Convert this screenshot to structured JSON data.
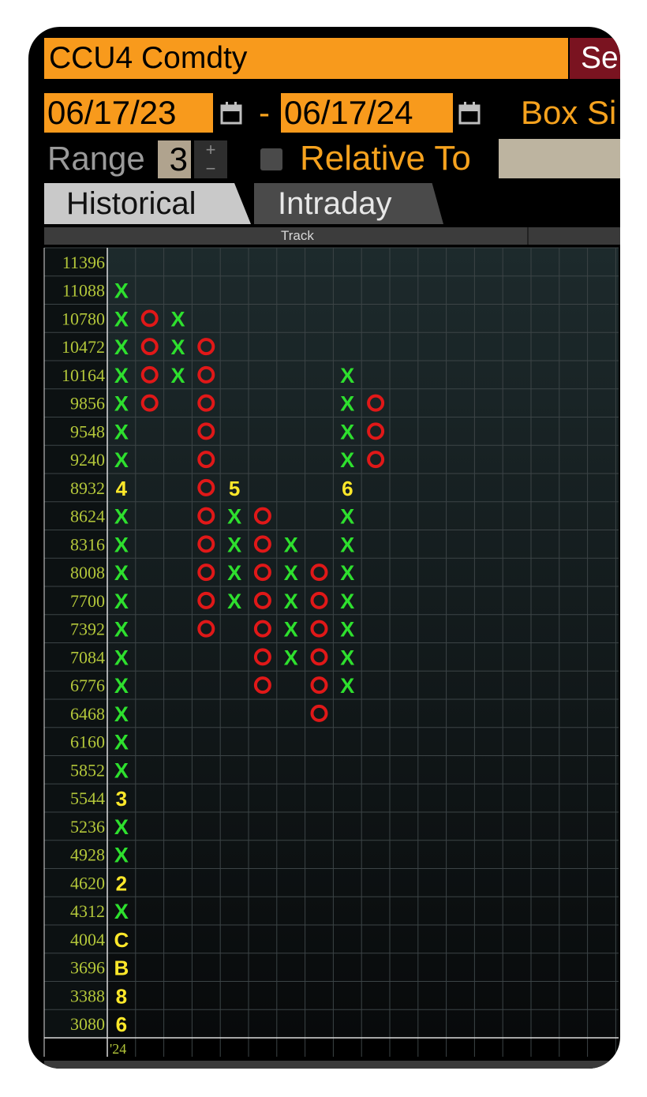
{
  "header": {
    "ticker": "CCU4 Comdty",
    "search_label": "Se",
    "start_date": "06/17/23",
    "date_separator": "-",
    "end_date": "06/17/24",
    "box_size_label": "Box Si",
    "range_label": "Range",
    "range_value": "3",
    "spinner_up": "+",
    "spinner_down": "−",
    "relative_to_label": "Relative To"
  },
  "tabs": [
    {
      "label": "Historical",
      "active": true
    },
    {
      "label": "Intraday",
      "active": false
    }
  ],
  "track_label": "Track",
  "colors": {
    "accent": "#f89a1c",
    "x_mark": "#2ee02e",
    "o_mark": "#e01818",
    "month_mark": "#ffe82a",
    "price_label": "#b3c63a"
  },
  "chart_data": {
    "type": "point-and-figure",
    "price_levels": [
      11396,
      11088,
      10780,
      10472,
      10164,
      9856,
      9548,
      9240,
      8932,
      8624,
      8316,
      8008,
      7700,
      7392,
      7084,
      6776,
      6468,
      6160,
      5852,
      5544,
      5236,
      4928,
      4620,
      4312,
      4004,
      3696,
      3388,
      3080
    ],
    "columns": [
      {
        "direction": "X",
        "low": 3080,
        "high": 11088,
        "month_marks": {
          "3080": "6",
          "3388": "8",
          "3696": "B",
          "4004": "C",
          "4620": "2",
          "5544": "3",
          "8932": "4"
        }
      },
      {
        "direction": "O",
        "low": 9856,
        "high": 10780,
        "month_marks": {}
      },
      {
        "direction": "X",
        "low": 10164,
        "high": 10780,
        "month_marks": {}
      },
      {
        "direction": "O",
        "low": 7392,
        "high": 10472,
        "month_marks": {}
      },
      {
        "direction": "X",
        "low": 7700,
        "high": 8932,
        "month_marks": {
          "8932": "5"
        }
      },
      {
        "direction": "O",
        "low": 6776,
        "high": 8624,
        "month_marks": {}
      },
      {
        "direction": "X",
        "low": 7084,
        "high": 8316,
        "month_marks": {}
      },
      {
        "direction": "O",
        "low": 6468,
        "high": 8008,
        "month_marks": {}
      },
      {
        "direction": "X",
        "low": 6776,
        "high": 10164,
        "month_marks": {
          "8932": "6"
        }
      },
      {
        "direction": "O",
        "low": 9240,
        "high": 9856,
        "month_marks": {}
      }
    ],
    "x_tick_labels": [
      "'24"
    ],
    "grid": true
  }
}
